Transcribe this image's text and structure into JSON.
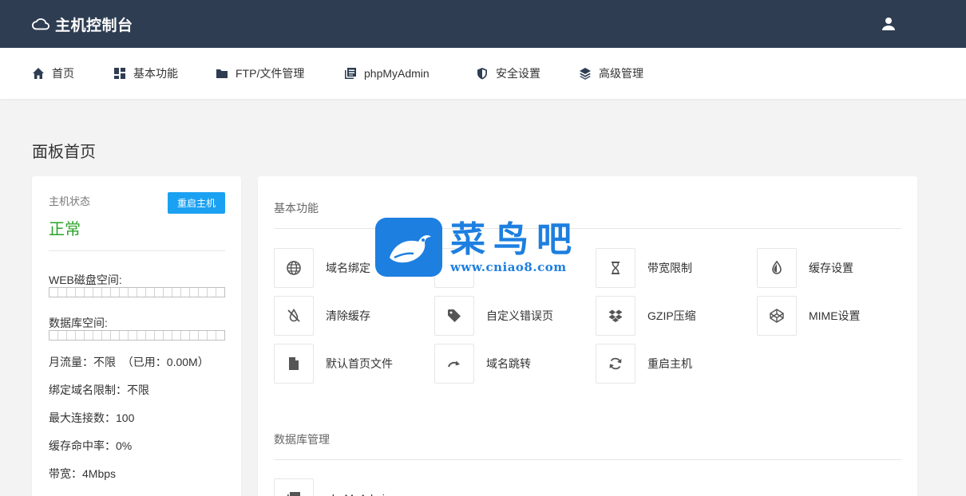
{
  "header": {
    "title": "主机控制台"
  },
  "nav": {
    "items": [
      {
        "label": "首页"
      },
      {
        "label": "基本功能"
      },
      {
        "label": "FTP/文件管理"
      },
      {
        "label": "phpMyAdmin"
      },
      {
        "label": "安全设置"
      },
      {
        "label": "高级管理"
      }
    ]
  },
  "page": {
    "title": "面板首页"
  },
  "host": {
    "status_label": "主机状态",
    "status_value": "正常",
    "restart_label": "重启主机",
    "web_disk_label": "WEB磁盘空间:",
    "web_disk_used": 0,
    "db_space_label": "数据库空间:",
    "db_space_used": 0,
    "monthly_traffic": "月流量：不限  （已用：0.00M）",
    "domain_limit": "绑定域名限制：不限",
    "max_connections": "最大连接数：100",
    "cache_hit_rate": "缓存命中率：0%",
    "bandwidth": "带宽：4Mbps"
  },
  "basic": {
    "section_title": "基本功能",
    "features": [
      {
        "label": "域名绑定",
        "icon": "globe-icon"
      },
      {
        "label": "",
        "icon": ""
      },
      {
        "label": "带宽限制",
        "icon": "hourglass-icon"
      },
      {
        "label": "缓存设置",
        "icon": "contrast-icon"
      },
      {
        "label": "清除缓存",
        "icon": "no-cache-icon"
      },
      {
        "label": "自定义错误页",
        "icon": "tag-icon"
      },
      {
        "label": "GZIP压缩",
        "icon": "dropbox-icon"
      },
      {
        "label": "MIME设置",
        "icon": "codepen-icon"
      },
      {
        "label": "默认首页文件",
        "icon": "file-icon"
      },
      {
        "label": "域名跳转",
        "icon": "redo-arrow-icon"
      },
      {
        "label": "重启主机",
        "icon": "sync-icon"
      }
    ]
  },
  "database": {
    "section_title": "数据库管理",
    "items": [
      {
        "label": "phpMyAdmin"
      }
    ]
  },
  "watermark": {
    "text": "菜鸟吧",
    "url": "www.cniao8.com"
  },
  "colors": {
    "header_bg": "#2e3d52",
    "accent": "#1ba1f2",
    "status_ok": "#2aa22a",
    "watermark": "#1d7fe0"
  }
}
